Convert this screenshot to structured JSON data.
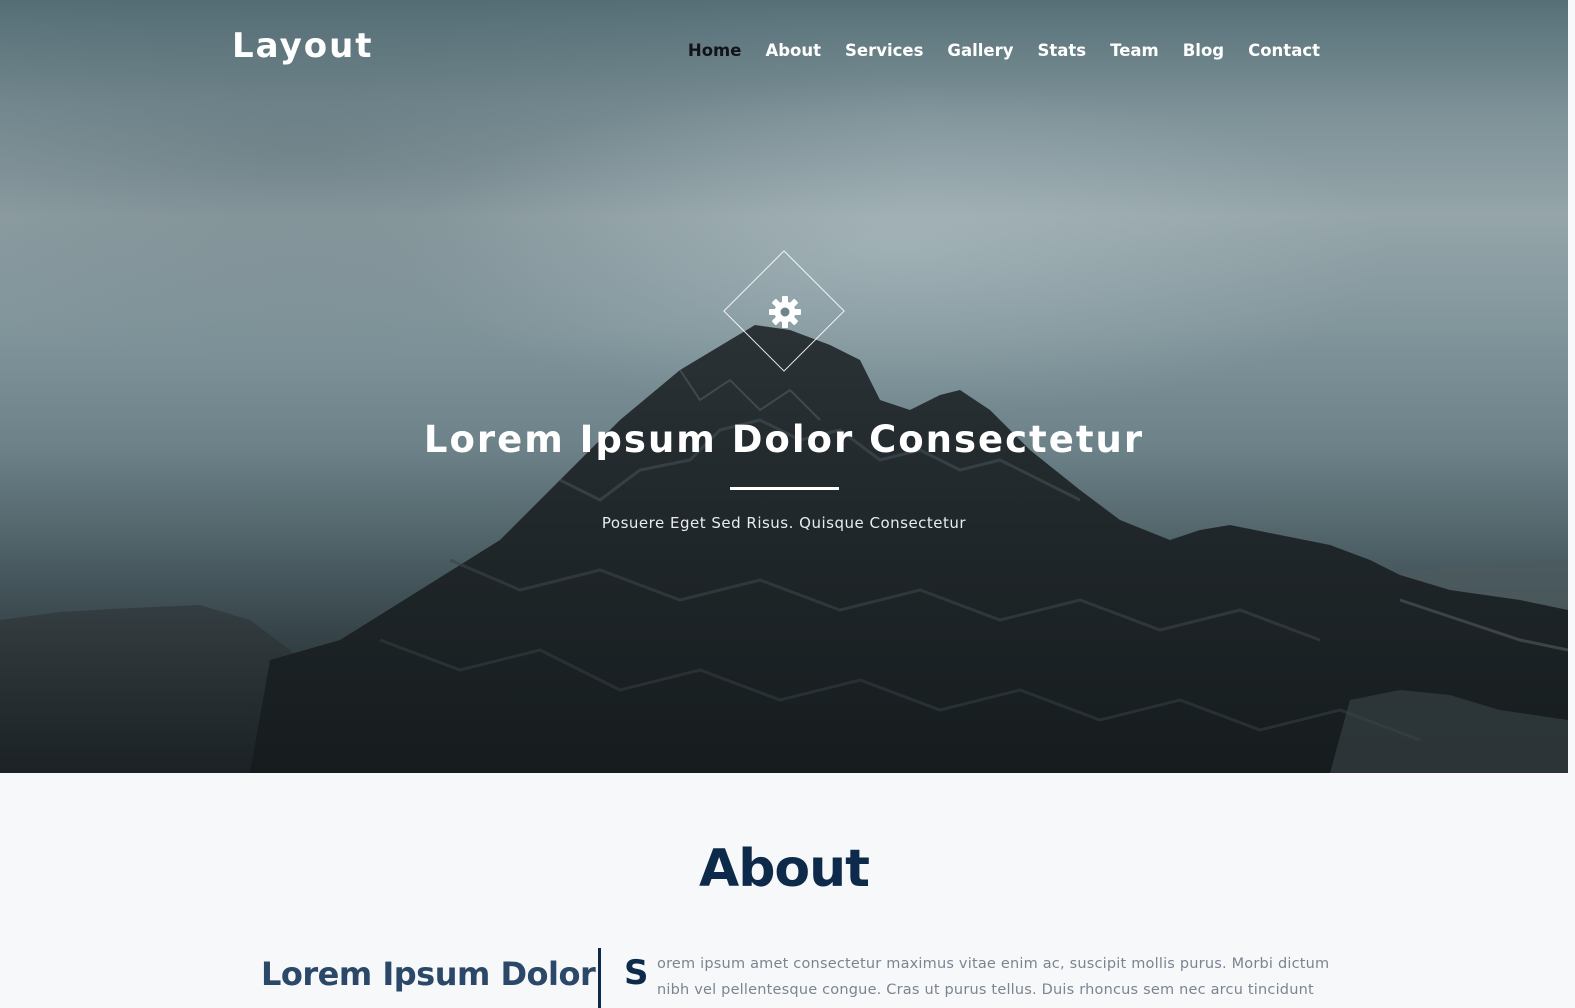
{
  "brand": {
    "logo": "Layout"
  },
  "nav": {
    "items": [
      {
        "label": "Home",
        "active": true
      },
      {
        "label": "About"
      },
      {
        "label": "Services"
      },
      {
        "label": "Gallery"
      },
      {
        "label": "Stats"
      },
      {
        "label": "Team"
      },
      {
        "label": "Blog"
      },
      {
        "label": "Contact"
      }
    ]
  },
  "hero": {
    "icon": "gear-icon",
    "title": "Lorem Ipsum Dolor Consectetur",
    "subtitle": "Posuere Eget Sed Risus. Quisque Consectetur"
  },
  "about": {
    "heading": "About",
    "subheading": "Lorem Ipsum Dolor",
    "dropcap": "S",
    "text_line1": "orem ipsum amet consectetur maximus vitae enim ac, suscipit mollis purus. Morbi dictum",
    "text_line2": "nibh vel pellentesque congue. Cras ut purus tellus. Duis rhoncus sem nec arcu tincidunt"
  },
  "colors": {
    "navy": "#0d2a4a",
    "about_bg": "#f6f8fa",
    "muted_text": "#7a8592"
  }
}
